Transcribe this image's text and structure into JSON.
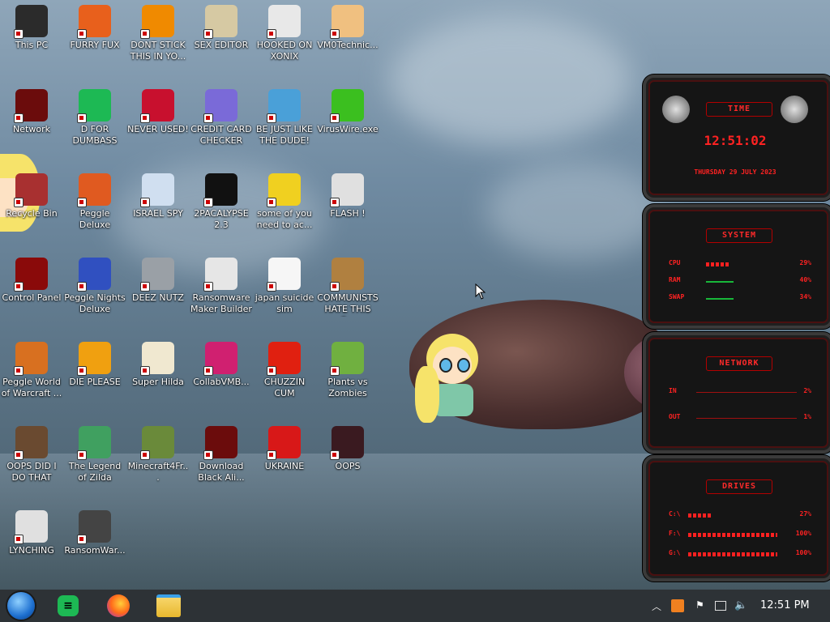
{
  "desktop": {
    "icons": [
      {
        "label": "This PC",
        "icon": "computer-icon",
        "color": "#2b2b2b"
      },
      {
        "label": "FURRY FUX",
        "icon": "firefox-icon",
        "color": "#e8601c"
      },
      {
        "label": "DONT STICK THIS IN YO...",
        "icon": "vlc-cone-icon",
        "color": "#f08a00"
      },
      {
        "label": "SEX EDITOR",
        "icon": "hxd-icon",
        "color": "#d6c9a3"
      },
      {
        "label": "HOOKED ON XONIX",
        "icon": "xonix-icon",
        "color": "#e8e8e8"
      },
      {
        "label": "VM0Technic...",
        "icon": "doctor-icon",
        "color": "#f0c080"
      },
      {
        "label": "Network",
        "icon": "alienware-network-icon",
        "color": "#6b0c0c"
      },
      {
        "label": "D FOR DUMBASS",
        "icon": "spotify-like-icon",
        "color": "#1db954"
      },
      {
        "label": "NEVER USED!",
        "icon": "devcpp-icon",
        "color": "#c8102e"
      },
      {
        "label": "CREDIT CARD CHECKER",
        "icon": "credit-card-icon",
        "color": "#7a6ad8"
      },
      {
        "label": "BE JUST LIKE THE DUDE!",
        "icon": "santa-icon",
        "color": "#4aa0d8"
      },
      {
        "label": "VirusWire.exe",
        "icon": "lime-icon",
        "color": "#3bbf1f"
      },
      {
        "label": "Recycle Bin",
        "icon": "recycle-bin-icon",
        "color": "#a83030"
      },
      {
        "label": "Peggle Deluxe",
        "icon": "peggle-icon",
        "color": "#e05a20"
      },
      {
        "label": "ISRAEL SPY",
        "icon": "spy-camera-icon",
        "color": "#d0dff0"
      },
      {
        "label": "2PACALYPSE 2.3",
        "icon": "terminal-icon",
        "color": "#111111"
      },
      {
        "label": "some of you need to ac...",
        "icon": "dog-icon",
        "color": "#f0d020"
      },
      {
        "label": "FLASH !",
        "icon": "flash-icon",
        "color": "#e0e0e0"
      },
      {
        "label": "Control Panel",
        "icon": "control-panel-icon",
        "color": "#8a0a0a"
      },
      {
        "label": "Peggle Nights Deluxe",
        "icon": "peggle-nights-icon",
        "color": "#3050c0"
      },
      {
        "label": "DEEZ NUTZ",
        "icon": "stacked-windows-icon",
        "color": "#9aa0a6"
      },
      {
        "label": "Ransomware Maker Builder .exe",
        "icon": "app-window-icon",
        "color": "#e6e6e6"
      },
      {
        "label": "japan suicide sim",
        "icon": "japan-sim-icon",
        "color": "#f6f6f6"
      },
      {
        "label": "COMMUNISTS HATE THIS G...",
        "icon": "money-bag-icon",
        "color": "#b08040"
      },
      {
        "label": "Peggle World of Warcraft ...",
        "icon": "peggle-wow-icon",
        "color": "#d87020"
      },
      {
        "label": "DIE PLEASE",
        "icon": "de-icon",
        "color": "#f0a010"
      },
      {
        "label": "Super Hilda",
        "icon": "pixel-cat-icon",
        "color": "#f0e8d0"
      },
      {
        "label": "CollabVMB...",
        "icon": "collabvm-icon",
        "color": "#d02070"
      },
      {
        "label": "CHUZZIN CUM",
        "icon": "chuzzle-icon",
        "color": "#e02010"
      },
      {
        "label": "Plants vs Zombies",
        "icon": "pvz-icon",
        "color": "#70b040"
      },
      {
        "label": "OOPS DID I DO THAT",
        "icon": "portrait-icon",
        "color": "#6a4a30"
      },
      {
        "label": "The Legend of Zilda",
        "icon": "zelda-sprite-icon",
        "color": "#40a060"
      },
      {
        "label": "Minecraft4Fr...",
        "icon": "minecraft-icon",
        "color": "#6a8a3a"
      },
      {
        "label": "Download Black Ali...",
        "icon": "alienware-icon",
        "color": "#6b0c0c"
      },
      {
        "label": "UKRAINE",
        "icon": "radiation-icon",
        "color": "#d81818"
      },
      {
        "label": "OOPS",
        "icon": "dark-app-icon",
        "color": "#3a1a20"
      },
      {
        "label": "LYNCHING",
        "icon": "noose-icon",
        "color": "#e0e0e0"
      },
      {
        "label": "RansomWar...",
        "icon": "skull-icon",
        "color": "#444444"
      }
    ]
  },
  "gadget": {
    "time": {
      "title": "TIME",
      "clock": "12:51:02",
      "date": "THURSDAY 29 JULY 2023"
    },
    "system": {
      "title": "SYSTEM",
      "rows": [
        {
          "key": "CPU",
          "value": "29%",
          "level": 0.29
        },
        {
          "key": "RAM",
          "value": "40%",
          "level": 0.4
        },
        {
          "key": "SWAP",
          "value": "34%",
          "level": 0.34
        }
      ]
    },
    "network": {
      "title": "NETWORK",
      "rows": [
        {
          "key": "IN",
          "value": "2%"
        },
        {
          "key": "OUT",
          "value": "1%"
        }
      ]
    },
    "drives": {
      "title": "DRIVES",
      "rows": [
        {
          "key": "C:\\",
          "value": "27%",
          "level": 0.27
        },
        {
          "key": "F:\\",
          "value": "100%",
          "level": 1.0
        },
        {
          "key": "G:\\",
          "value": "100%",
          "level": 1.0
        }
      ]
    }
  },
  "taskbar": {
    "start": "start-orb-icon",
    "apps": [
      "whatsapp-like-icon",
      "firefox-icon",
      "file-explorer-icon"
    ],
    "tray": [
      "chevron-up-icon",
      "shield-app-icon",
      "flag-icon",
      "network-icon",
      "volume-icon"
    ],
    "clock": "12:51 PM"
  },
  "colors": {
    "accent": "#ff2222",
    "taskbar": "#2d3236"
  }
}
